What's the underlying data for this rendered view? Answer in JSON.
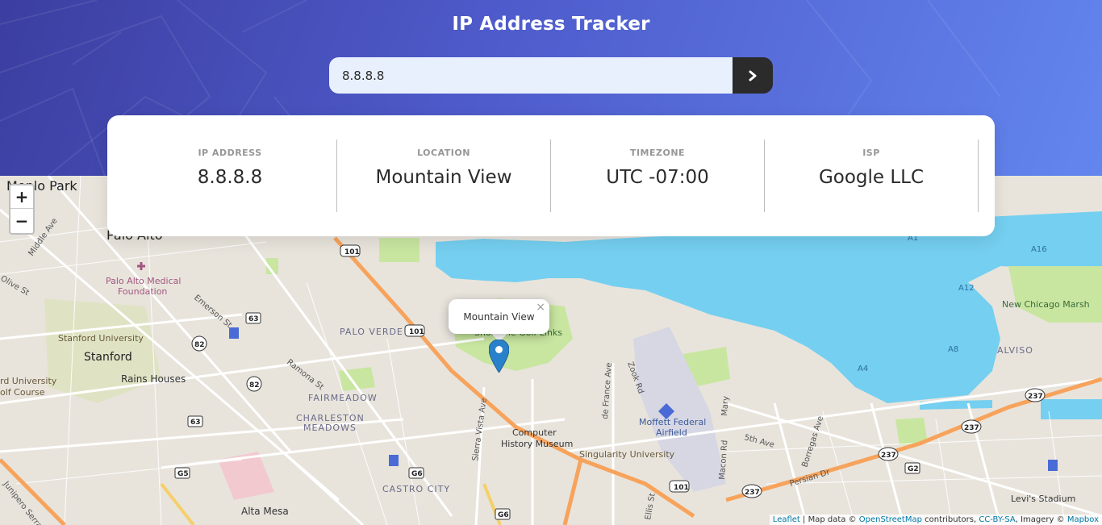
{
  "header": {
    "title": "IP Address Tracker"
  },
  "search": {
    "value": "8.8.8.8",
    "button_icon": "chevron-right-icon"
  },
  "info": [
    {
      "label": "IP ADDRESS",
      "value": "8.8.8.8"
    },
    {
      "label": "LOCATION",
      "value": "Mountain View"
    },
    {
      "label": "TIMEZONE",
      "value": "UTC -07:00"
    },
    {
      "label": "ISP",
      "value": "Google LLC"
    }
  ],
  "map": {
    "zoom_in": "+",
    "zoom_out": "−",
    "popup_text": "Mountain View",
    "popup_close": "×",
    "labels": {
      "menlo_park": "Menlo Park",
      "palo_alto": "Palo Alto",
      "palo_alto_medical": "Palo Alto Medical",
      "foundation": "Foundation",
      "stanford_university": "Stanford University",
      "stanford": "Stanford",
      "rains_houses": "Rains Houses",
      "stanford_univ_partial": "rd University",
      "golf_course": "olf Course",
      "palo_verde": "PALO VERDE",
      "fairmeadow": "FAIRMEADOW",
      "charleston": "CHARLESTON",
      "meadows": "MEADOWS",
      "computer": "Computer",
      "history_museum": "History Museum",
      "singularity": "Singularity University",
      "moffett": "Moffett Federal",
      "airfield": "Airfield",
      "castro_city": "CASTRO CITY",
      "alta_mesa": "Alta Mesa",
      "new_chicago_marsh": "New Chicago Marsh",
      "alviso": "ALVISO",
      "levis_stadium": "Levi's Stadium",
      "golf_links": "Shoreline Golf Links",
      "emerson_st": "Emerson St",
      "ramona_st": "Ramona St",
      "middle_ave": "Middle Ave",
      "olive_st": "Olive St",
      "sierra_vista_ave": "Sierra Vista Ave",
      "de_france_ave": "de France Ave",
      "zook_rd": "Zook Rd",
      "mary": "Mary",
      "fifth_ave": "5th Ave",
      "borregas_ave": "Borregas Ave",
      "persian_dr": "Persian Dr",
      "macon_rd": "Macon Rd",
      "ellis_st": "Ellis St",
      "junipero": "Junipero Serra",
      "a4": "A4",
      "a8": "A8",
      "a12": "A12",
      "a16": "A16",
      "a1": "A1"
    },
    "shields": {
      "us101": "101",
      "r82": "82",
      "r63": "63",
      "r237": "237",
      "g5": "G5",
      "g6": "G6",
      "g2": "G2"
    }
  },
  "attribution": {
    "leaflet": "Leaflet",
    "map_data": " | Map data © ",
    "osm": "OpenStreetMap",
    "contributors": " contributors, ",
    "ccbysa": "CC-BY-SA",
    "imagery": ", Imagery © ",
    "mapbox": "Mapbox"
  },
  "colors": {
    "header_start": "#3c3ea0",
    "header_end": "#6386ee",
    "water": "#75cff0",
    "park": "#c8e6a0",
    "highway": "#f7a35c",
    "road": "#ffffff",
    "land": "#e8e4dc",
    "marker": "#2a81cb"
  }
}
